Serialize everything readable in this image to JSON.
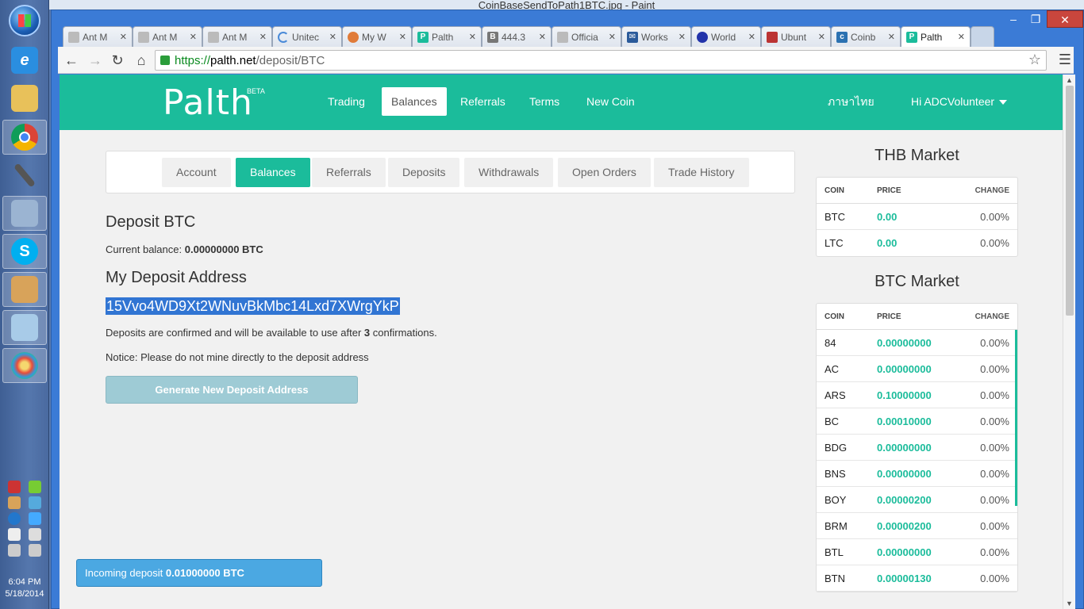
{
  "desktop": {
    "clock_time": "6:04 PM",
    "clock_date": "5/18/2014",
    "paint_title": "CoinBaseSendToPath1BTC.jpg - Paint"
  },
  "browser": {
    "tabs": [
      {
        "label": "Ant M",
        "icon": "page-icon"
      },
      {
        "label": "Ant M",
        "icon": "page-icon"
      },
      {
        "label": "Ant M",
        "icon": "page-icon"
      },
      {
        "label": "Unitec",
        "icon": "loading-icon"
      },
      {
        "label": "My W",
        "icon": "app-icon"
      },
      {
        "label": "Palth",
        "icon": "palth-icon"
      },
      {
        "label": "444.3",
        "icon": "bitcoin-icon"
      },
      {
        "label": "Officia",
        "icon": "page-icon"
      },
      {
        "label": "Works",
        "icon": "mail-icon"
      },
      {
        "label": "World",
        "icon": "clock-icon"
      },
      {
        "label": "Ubunt",
        "icon": "ubuntu-icon"
      },
      {
        "label": "Coinb",
        "icon": "coinbase-icon"
      },
      {
        "label": "Palth",
        "icon": "palth-icon"
      }
    ],
    "url": {
      "scheme": "https://",
      "host": "palth.net",
      "path": "/deposit/BTC"
    }
  },
  "site": {
    "logo": "Palth",
    "beta": "BETA",
    "nav": {
      "trading": "Trading",
      "balances": "Balances",
      "referrals": "Referrals",
      "terms": "Terms",
      "new_coin": "New Coin",
      "language": "ภาษาไทย",
      "user": "Hi ADCVolunteer"
    },
    "subnav": [
      "Account",
      "Balances",
      "Referrals",
      "Deposits",
      "Withdrawals",
      "Open Orders",
      "Trade History"
    ]
  },
  "deposit": {
    "heading": "Deposit BTC",
    "balance_label": "Current balance:",
    "balance_value": "0.00000000 BTC",
    "address_heading": "My Deposit Address",
    "address": "15Vvo4WD9Xt2WNuvBkMbc14Lxd7XWrgYkP",
    "confirm_pre": "Deposits are confirmed and will be available to use after",
    "confirm_count": "3",
    "confirm_post": "confirmations.",
    "notice": "Notice: Please do not mine directly to the deposit address",
    "generate_button": "Generate New Deposit Address"
  },
  "incoming": {
    "label": "Incoming deposit",
    "amount": "0.01000000 BTC"
  },
  "thb_market": {
    "title": "THB Market",
    "headers": {
      "coin": "COIN",
      "price": "PRICE",
      "change": "CHANGE"
    },
    "rows": [
      {
        "coin": "BTC",
        "price": "0.00",
        "change": "0.00%"
      },
      {
        "coin": "LTC",
        "price": "0.00",
        "change": "0.00%"
      }
    ]
  },
  "btc_market": {
    "title": "BTC Market",
    "headers": {
      "coin": "COIN",
      "price": "PRICE",
      "change": "CHANGE"
    },
    "rows": [
      {
        "coin": "84",
        "price": "0.00000000",
        "change": "0.00%"
      },
      {
        "coin": "AC",
        "price": "0.00000000",
        "change": "0.00%"
      },
      {
        "coin": "ARS",
        "price": "0.10000000",
        "change": "0.00%"
      },
      {
        "coin": "BC",
        "price": "0.00010000",
        "change": "0.00%"
      },
      {
        "coin": "BDG",
        "price": "0.00000000",
        "change": "0.00%"
      },
      {
        "coin": "BNS",
        "price": "0.00000000",
        "change": "0.00%"
      },
      {
        "coin": "BOY",
        "price": "0.00000200",
        "change": "0.00%"
      },
      {
        "coin": "BRM",
        "price": "0.00000200",
        "change": "0.00%"
      },
      {
        "coin": "BTL",
        "price": "0.00000000",
        "change": "0.00%"
      },
      {
        "coin": "BTN",
        "price": "0.00000130",
        "change": "0.00%"
      }
    ]
  },
  "colors": {
    "brand": "#1bbc9b",
    "selection": "#3175d3",
    "incoming": "#4ba8e2"
  }
}
